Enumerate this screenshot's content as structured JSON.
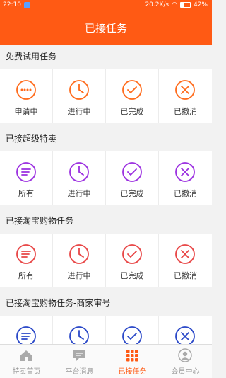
{
  "status_bar": {
    "time": "22:10",
    "speed": "20.2K/s",
    "battery": "42%"
  },
  "header": {
    "title": "已接任务"
  },
  "colors": {
    "accent": "#ff5a14",
    "orange": "#ff6a1a",
    "purple": "#9b2fe0",
    "red": "#e84545",
    "blue": "#2a48c8"
  },
  "sections": [
    {
      "title": "免费试用任务",
      "color": "orange",
      "items": [
        {
          "label": "申请中",
          "icon": "dots-icon"
        },
        {
          "label": "进行中",
          "icon": "clock-icon"
        },
        {
          "label": "已完成",
          "icon": "check-icon"
        },
        {
          "label": "已撤消",
          "icon": "cross-icon"
        }
      ]
    },
    {
      "title": "已接超级特卖",
      "color": "purple",
      "items": [
        {
          "label": "所有",
          "icon": "list-icon"
        },
        {
          "label": "进行中",
          "icon": "clock-icon"
        },
        {
          "label": "已完成",
          "icon": "check-icon"
        },
        {
          "label": "已撤消",
          "icon": "cross-icon"
        }
      ]
    },
    {
      "title": "已接淘宝购物任务",
      "color": "red",
      "items": [
        {
          "label": "所有",
          "icon": "list-icon"
        },
        {
          "label": "进行中",
          "icon": "clock-icon"
        },
        {
          "label": "已完成",
          "icon": "check-icon"
        },
        {
          "label": "已撤消",
          "icon": "cross-icon"
        }
      ]
    },
    {
      "title": "已接淘宝购物任务-商家审号",
      "color": "blue",
      "items": [
        {
          "label": "",
          "icon": "list-icon"
        },
        {
          "label": "",
          "icon": "clock-icon"
        },
        {
          "label": "",
          "icon": "check-icon"
        },
        {
          "label": "",
          "icon": "cross-icon"
        }
      ]
    }
  ],
  "tabs": [
    {
      "label": "特卖首页",
      "icon": "home-icon"
    },
    {
      "label": "平台消息",
      "icon": "message-icon"
    },
    {
      "label": "已接任务",
      "icon": "grid-icon",
      "active": true
    },
    {
      "label": "会员中心",
      "icon": "user-icon"
    }
  ]
}
